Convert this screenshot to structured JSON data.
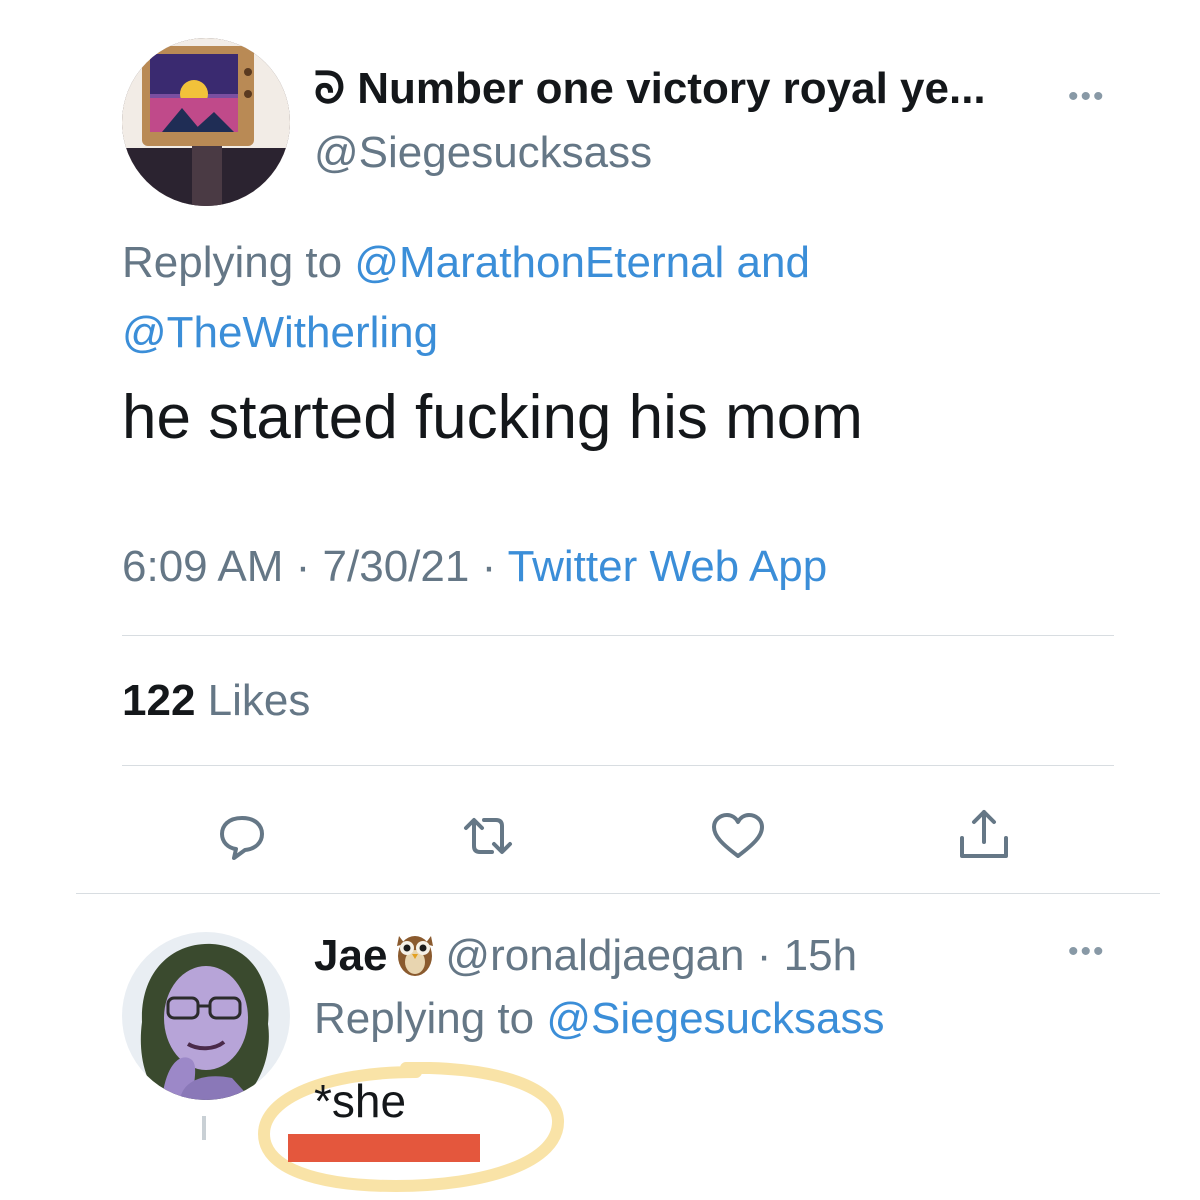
{
  "tweet": {
    "display_name": "ᘐ Number one victory royal ye...",
    "handle": "@Siegesucksass",
    "more": "•••",
    "replying_prefix": "Replying to ",
    "replying_mention_1": "@MarathonEternal",
    "replying_and": " and",
    "replying_mention_2": "@TheWitherling",
    "text": "he started fucking his mom",
    "time": "6:09 AM",
    "sep1": " · ",
    "date": "7/30/21",
    "sep2": " · ",
    "source": "Twitter Web App",
    "likes_count": "122",
    "likes_label": " Likes"
  },
  "actions": {
    "reply_icon": "reply-icon",
    "retweet_icon": "retweet-icon",
    "like_icon": "heart-icon",
    "share_icon": "share-icon"
  },
  "reply": {
    "name": "Jae",
    "handle": "@ronaldjaegan",
    "sep": " · ",
    "age": "15h",
    "more": "•••",
    "replying_prefix": "Replying to ",
    "replying_mention": "@Siegesucksass",
    "text": "*she"
  },
  "colors": {
    "link": "#3b8ed8",
    "secondary": "#657786",
    "highlight": "#f7d98a",
    "redaction": "#e4573d"
  }
}
